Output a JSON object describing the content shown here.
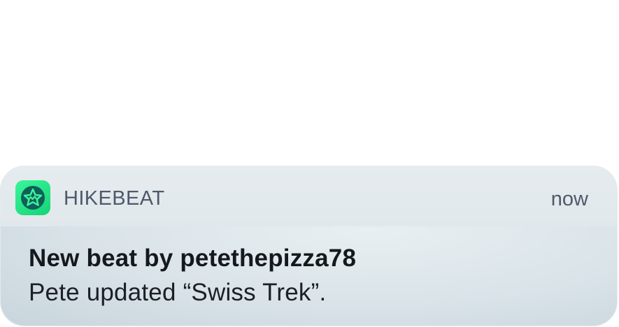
{
  "notification": {
    "app_name": "HIKEBEAT",
    "timestamp": "now",
    "title": "New beat by petethepizza78",
    "message": "Pete updated “Swiss Trek”.",
    "app_icon": "hikebeat-star-logo-icon"
  },
  "colors": {
    "icon_green": "#22e07f",
    "icon_dark": "#0f5f5a",
    "header_bg": "#e2e9ec",
    "body_bg": "#d8e2e7",
    "secondary_text": "#4d5a6a"
  }
}
